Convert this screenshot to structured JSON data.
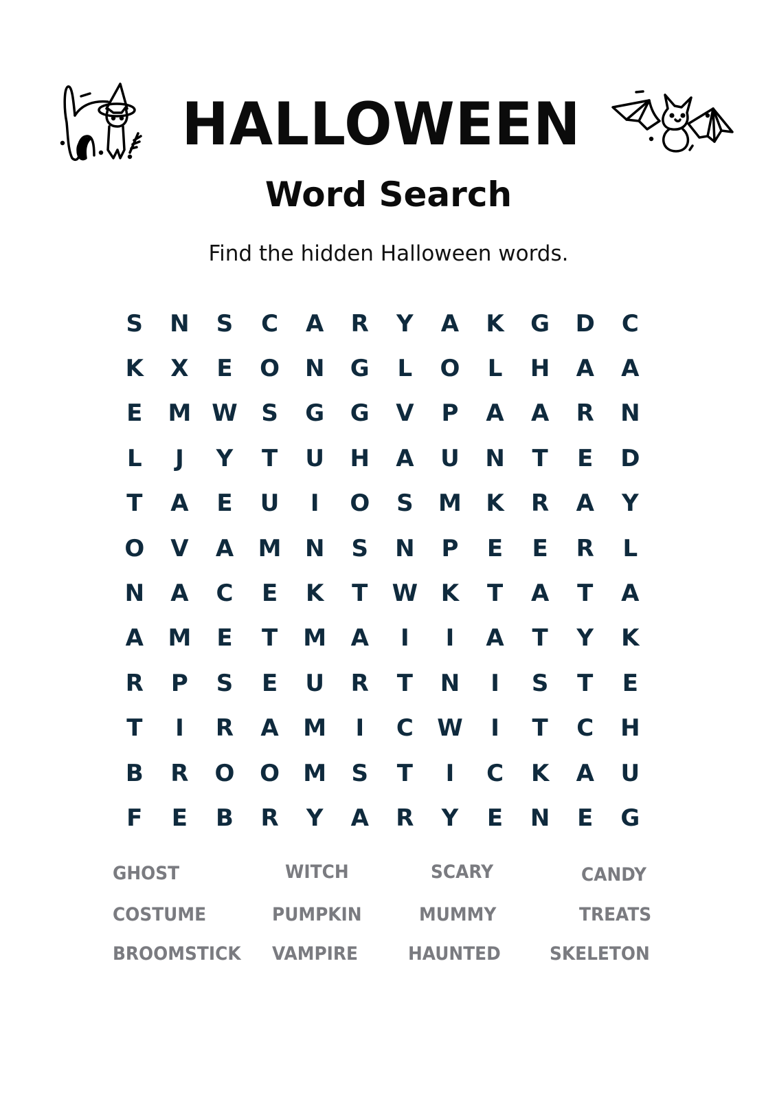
{
  "title": "HALLOWEEN",
  "subtitle": "Word Search",
  "instructions": "Find the hidden Halloween words.",
  "illustrations": {
    "left": "cat-with-witch-hat-icon",
    "right": "bat-icon"
  },
  "colors": {
    "grid_letters": "#0f2a3d",
    "word_list": "#7a7b80",
    "title": "#0b0b0b"
  },
  "grid": [
    [
      "S",
      "N",
      "S",
      "C",
      "A",
      "R",
      "Y",
      "A",
      "K",
      "G",
      "D",
      "C"
    ],
    [
      "K",
      "X",
      "E",
      "O",
      "N",
      "G",
      "L",
      "O",
      "L",
      "H",
      "A",
      "A"
    ],
    [
      "E",
      "M",
      "W",
      "S",
      "G",
      "G",
      "V",
      "P",
      "A",
      "A",
      "R",
      "N"
    ],
    [
      "L",
      "J",
      "Y",
      "T",
      "U",
      "H",
      "A",
      "U",
      "N",
      "T",
      "E",
      "D"
    ],
    [
      "T",
      "A",
      "E",
      "U",
      "I",
      "O",
      "S",
      "M",
      "K",
      "R",
      "A",
      "Y"
    ],
    [
      "O",
      "V",
      "A",
      "M",
      "N",
      "S",
      "N",
      "P",
      "E",
      "E",
      "R",
      "L"
    ],
    [
      "N",
      "A",
      "C",
      "E",
      "K",
      "T",
      "W",
      "K",
      "T",
      "A",
      "T",
      "A"
    ],
    [
      "A",
      "M",
      "E",
      "T",
      "M",
      "A",
      "I",
      "I",
      "A",
      "T",
      "Y",
      "K"
    ],
    [
      "R",
      "P",
      "S",
      "E",
      "U",
      "R",
      "T",
      "N",
      "I",
      "S",
      "T",
      "E"
    ],
    [
      "T",
      "I",
      "R",
      "A",
      "M",
      "I",
      "C",
      "W",
      "I",
      "T",
      "C",
      "H"
    ],
    [
      "B",
      "R",
      "O",
      "O",
      "M",
      "S",
      "T",
      "I",
      "C",
      "K",
      "A",
      "U"
    ],
    [
      "F",
      "E",
      "B",
      "R",
      "Y",
      "A",
      "R",
      "Y",
      "E",
      "N",
      "E",
      "G"
    ]
  ],
  "words": [
    "GHOST",
    "WITCH",
    "SCARY",
    "CANDY",
    "COSTUME",
    "PUMPKIN",
    "MUMMY",
    "TREATS",
    "BROOMSTICK",
    "VAMPIRE",
    "HAUNTED",
    "SKELETON"
  ]
}
